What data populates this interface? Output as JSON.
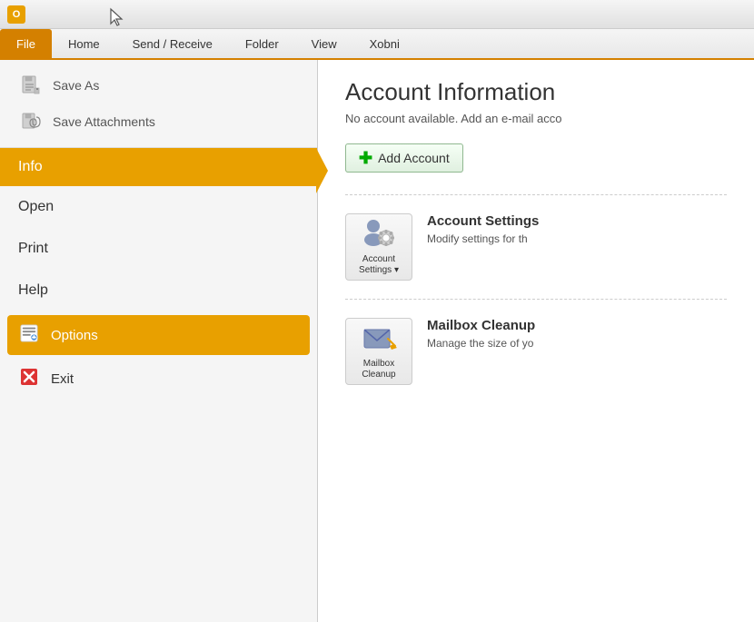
{
  "titlebar": {
    "icon_label": "O"
  },
  "ribbon": {
    "tabs": [
      {
        "label": "File",
        "active": true
      },
      {
        "label": "Home",
        "active": false
      },
      {
        "label": "Send / Receive",
        "active": false
      },
      {
        "label": "Folder",
        "active": false
      },
      {
        "label": "View",
        "active": false
      },
      {
        "label": "Xobni",
        "active": false
      }
    ]
  },
  "sidebar": {
    "top_items": [
      {
        "id": "save-as",
        "label": "Save As"
      },
      {
        "id": "save-attachments",
        "label": "Save Attachments"
      }
    ],
    "info_label": "Info",
    "nav_items": [
      {
        "id": "open",
        "label": "Open"
      },
      {
        "id": "print",
        "label": "Print"
      },
      {
        "id": "help",
        "label": "Help"
      }
    ],
    "options_label": "Options",
    "exit_label": "Exit"
  },
  "content": {
    "title": "Account Information",
    "subtitle": "No account available. Add an e-mail acco",
    "add_account_label": "Add Account",
    "sections": [
      {
        "id": "account-settings",
        "icon_label": "Account\nSettings",
        "dropdown": true,
        "heading": "Account Settings",
        "description": "Modify settings for th"
      },
      {
        "id": "mailbox-cleanup",
        "icon_label": "Mailbox\nCleanup",
        "dropdown": false,
        "heading": "Mailbox Cleanup",
        "description": "Manage the size of yo"
      }
    ]
  },
  "colors": {
    "orange": "#e8a000",
    "dark_orange": "#d48000",
    "green": "#00aa00",
    "highlight_orange": "#f5a000"
  }
}
